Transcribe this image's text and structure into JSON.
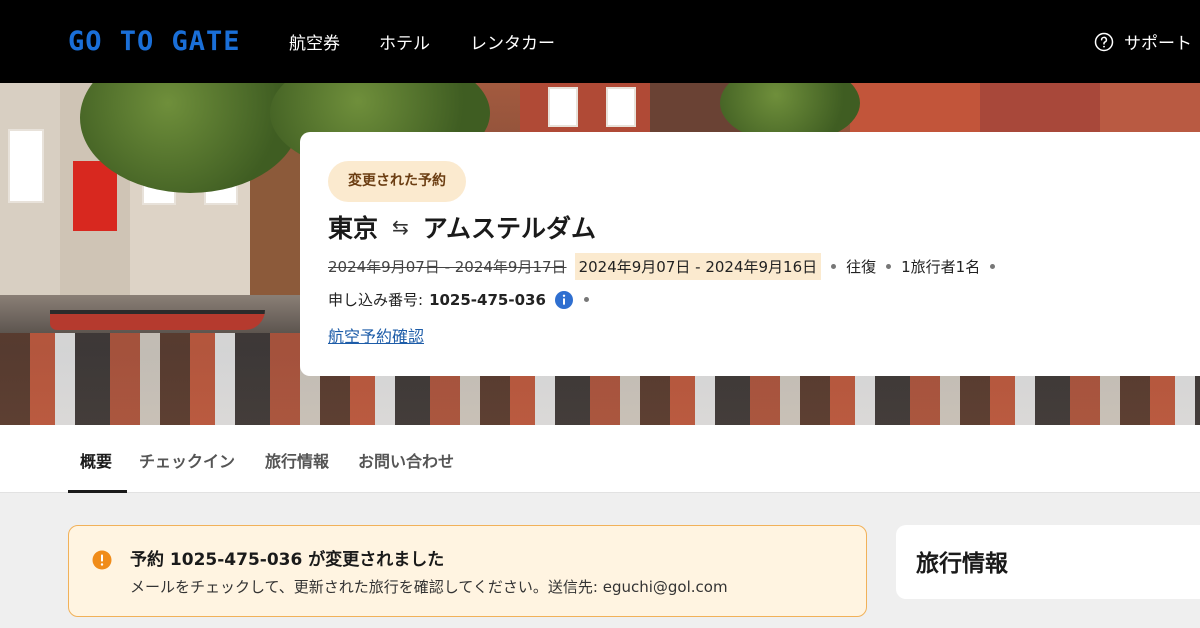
{
  "header": {
    "logo": "GO TO GATE",
    "nav": [
      {
        "label": "航空券"
      },
      {
        "label": "ホテル"
      },
      {
        "label": "レンタカー"
      }
    ],
    "support_label": "サポート",
    "support_icon": "question-circle-icon"
  },
  "booking": {
    "badge": "変更された予約",
    "origin": "東京",
    "route_icon": "round-trip-arrows-icon",
    "route_arrows": "⇆",
    "destination": "アムステルダム",
    "old_dates": "2024年9月07日 - 2024年9月17日",
    "new_dates": "2024年9月07日 - 2024年9月16日",
    "trip_type": "往復",
    "travelers": "1旅行者1名",
    "reference_label": "申し込み番号:",
    "reference_number": "1025-475-036",
    "confirm_link": "航空予約確認"
  },
  "tabs": [
    {
      "label": "概要",
      "active": true
    },
    {
      "label": "チェックイン",
      "active": false
    },
    {
      "label": "旅行情報",
      "active": false
    },
    {
      "label": "お問い合わせ",
      "active": false
    }
  ],
  "alert": {
    "icon": "warning-circle-icon",
    "title": "予約 1025-475-036 が変更されました",
    "text": "メールをチェックして、更新された旅行を確認してください。送信先: eguchi@gol.com"
  },
  "side_panel": {
    "title": "旅行情報"
  },
  "colors": {
    "header_bg": "#000000",
    "logo_blue": "#1a6fd8",
    "badge_bg": "#fbeacf",
    "alert_bg": "#fff4e1",
    "alert_border": "#f1b159",
    "alert_icon": "#f08c1a",
    "link": "#1d5ca8",
    "info_icon": "#2f6fd0"
  }
}
